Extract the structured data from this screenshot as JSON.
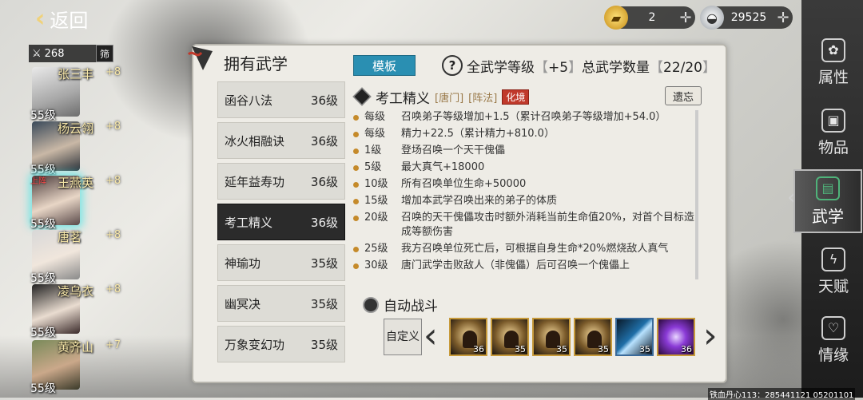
{
  "back_label": "返回",
  "currency": {
    "gold": "2",
    "silver": "29525"
  },
  "roster": {
    "power": "268",
    "filter_label": "筛",
    "heroes": [
      {
        "name": "张三丰",
        "plus": "+8",
        "level": "55级"
      },
      {
        "name": "杨云翎",
        "plus": "+8",
        "level": "55级"
      },
      {
        "name": "王燕英",
        "plus": "+8",
        "level": "55级",
        "tag": "上阵"
      },
      {
        "name": "唐茗",
        "plus": "+8",
        "level": "55级"
      },
      {
        "name": "凌乌衣",
        "plus": "+8",
        "level": "55级"
      },
      {
        "name": "黄齐山",
        "plus": "+7",
        "level": "55级"
      }
    ]
  },
  "panel": {
    "title": "拥有武学",
    "template_btn": "模板",
    "total_level_label": "全武学等级",
    "total_level_value": "+5",
    "total_count_label": "总武学数量",
    "total_count_value": "22/20"
  },
  "skills": [
    {
      "name": "函谷八法",
      "level": "36级"
    },
    {
      "name": "冰火相融诀",
      "level": "36级"
    },
    {
      "name": "延年益寿功",
      "level": "36级"
    },
    {
      "name": "考工精义",
      "level": "36级"
    },
    {
      "name": "神瑜功",
      "level": "35级"
    },
    {
      "name": "幽冥决",
      "level": "35级"
    },
    {
      "name": "万象变幻功",
      "level": "35级"
    }
  ],
  "detail": {
    "name": "考工精义",
    "sect": "[唐门]",
    "type": "[阵法]",
    "realm": "化境",
    "forget_btn": "遗忘",
    "effects": [
      {
        "lvl": "每级",
        "text": "召唤弟子等级增加+1.5（累计召唤弟子等级增加+54.0）"
      },
      {
        "lvl": "每级",
        "text": "精力+22.5（累计精力+810.0）"
      },
      {
        "lvl": "1级",
        "text": "登场召唤一个天干傀儡"
      },
      {
        "lvl": "5级",
        "text": "最大真气+18000"
      },
      {
        "lvl": "10级",
        "text": "所有召唤单位生命+50000"
      },
      {
        "lvl": "15级",
        "text": "增加本武学召唤出来的弟子的体质"
      },
      {
        "lvl": "20级",
        "text": "召唤的天干傀儡攻击时额外消耗当前生命值20%，对首个目标造成等额伤害"
      },
      {
        "lvl": "25级",
        "text": "我方召唤单位死亡后，可根据自身生命*20%燃烧敌人真气"
      },
      {
        "lvl": "30级",
        "text": "唐门武学击败敌人（非傀儡）后可召唤一个傀儡上"
      }
    ]
  },
  "auto_battle": {
    "title": "自动战斗",
    "custom_btn": "自定义",
    "slots": [
      {
        "num": "36",
        "kind": "monk"
      },
      {
        "num": "35",
        "kind": "monk"
      },
      {
        "num": "35",
        "kind": "monk"
      },
      {
        "num": "35",
        "kind": "monk"
      },
      {
        "num": "35",
        "kind": "blade"
      },
      {
        "num": "36",
        "kind": "purple"
      }
    ]
  },
  "nav": [
    {
      "label": "属性",
      "icon": "attributes-icon"
    },
    {
      "label": "物品",
      "icon": "items-icon"
    },
    {
      "label": "武学",
      "icon": "martial-arts-icon"
    },
    {
      "label": "天赋",
      "icon": "talent-icon"
    },
    {
      "label": "情缘",
      "icon": "relationship-icon"
    }
  ],
  "footer_id": "铁血丹心113：285441121 05201101"
}
